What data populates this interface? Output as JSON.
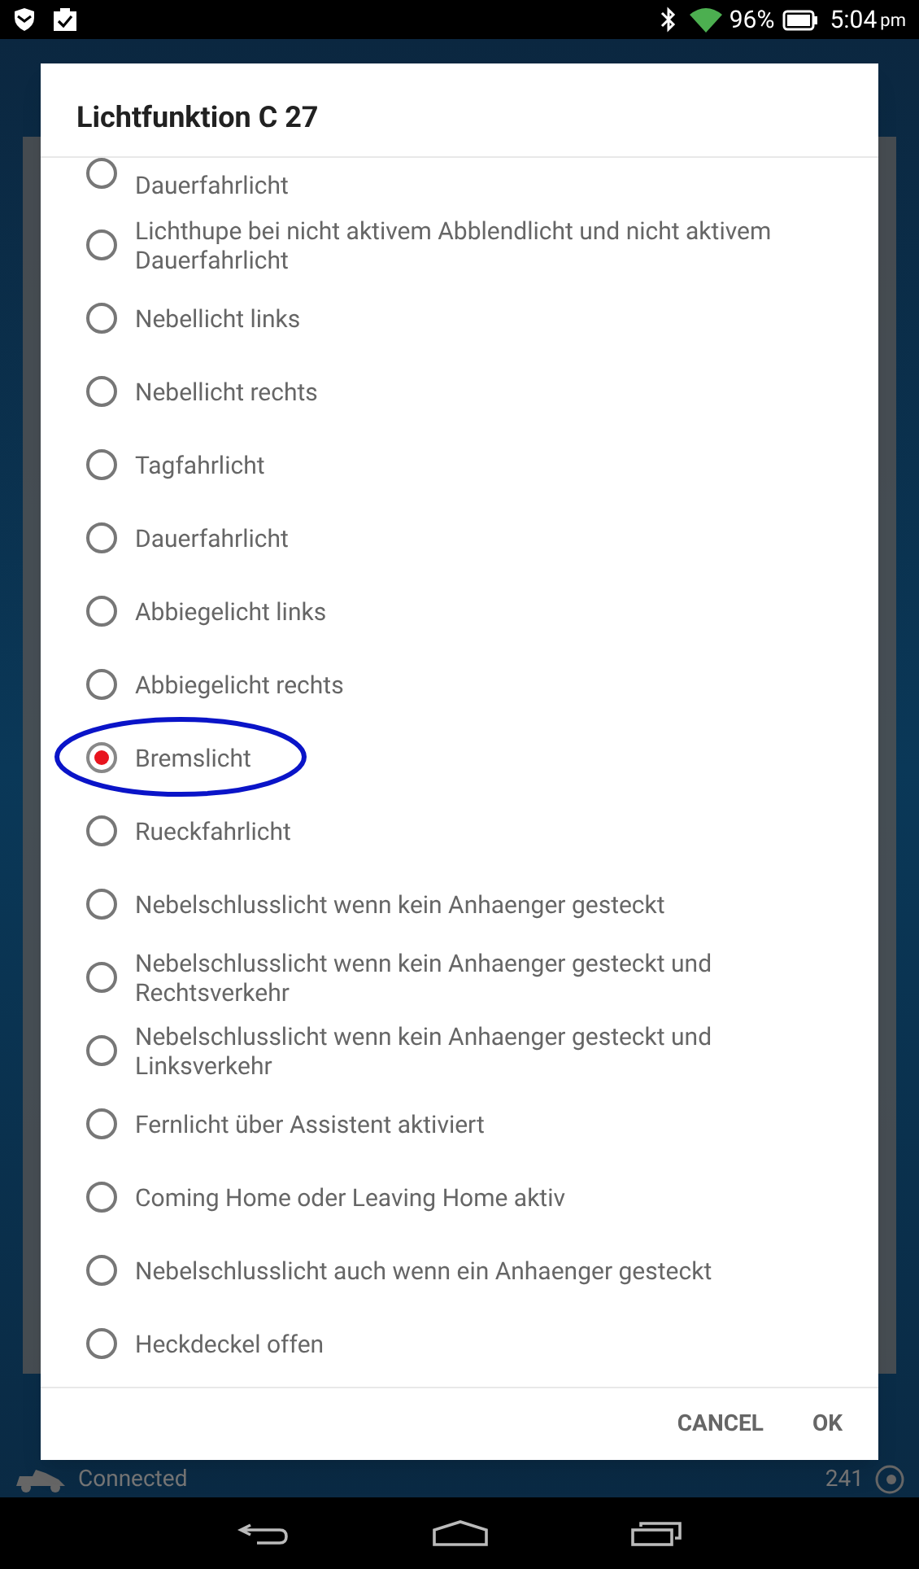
{
  "status_bar": {
    "battery": "96%",
    "time": "5:04",
    "ampm": "pm"
  },
  "background": {
    "connection": "Connected",
    "counter": "241"
  },
  "dialog": {
    "title": "Lichtfunktion C 27",
    "options": [
      {
        "label": "Dauerfahrlicht",
        "selected": false
      },
      {
        "label": "Lichthupe bei nicht aktivem Abblendlicht und nicht aktivem Dauerfahrlicht",
        "selected": false
      },
      {
        "label": "Nebellicht links",
        "selected": false
      },
      {
        "label": "Nebellicht rechts",
        "selected": false
      },
      {
        "label": "Tagfahrlicht",
        "selected": false
      },
      {
        "label": "Dauerfahrlicht",
        "selected": false
      },
      {
        "label": "Abbiegelicht links",
        "selected": false
      },
      {
        "label": "Abbiegelicht rechts",
        "selected": false
      },
      {
        "label": "Bremslicht",
        "selected": true
      },
      {
        "label": "Rueckfahrlicht",
        "selected": false
      },
      {
        "label": "Nebelschlusslicht wenn kein Anhaenger gesteckt",
        "selected": false
      },
      {
        "label": "Nebelschlusslicht wenn kein Anhaenger gesteckt und Rechtsverkehr",
        "selected": false
      },
      {
        "label": "Nebelschlusslicht wenn kein Anhaenger gesteckt und Linksverkehr",
        "selected": false
      },
      {
        "label": "Fernlicht über Assistent aktiviert",
        "selected": false
      },
      {
        "label": "Coming Home oder Leaving Home aktiv",
        "selected": false
      },
      {
        "label": "Nebelschlusslicht auch wenn ein Anhaenger gesteckt",
        "selected": false
      },
      {
        "label": "Heckdeckel offen",
        "selected": false
      }
    ],
    "buttons": [
      "CANCEL",
      "OK"
    ]
  }
}
